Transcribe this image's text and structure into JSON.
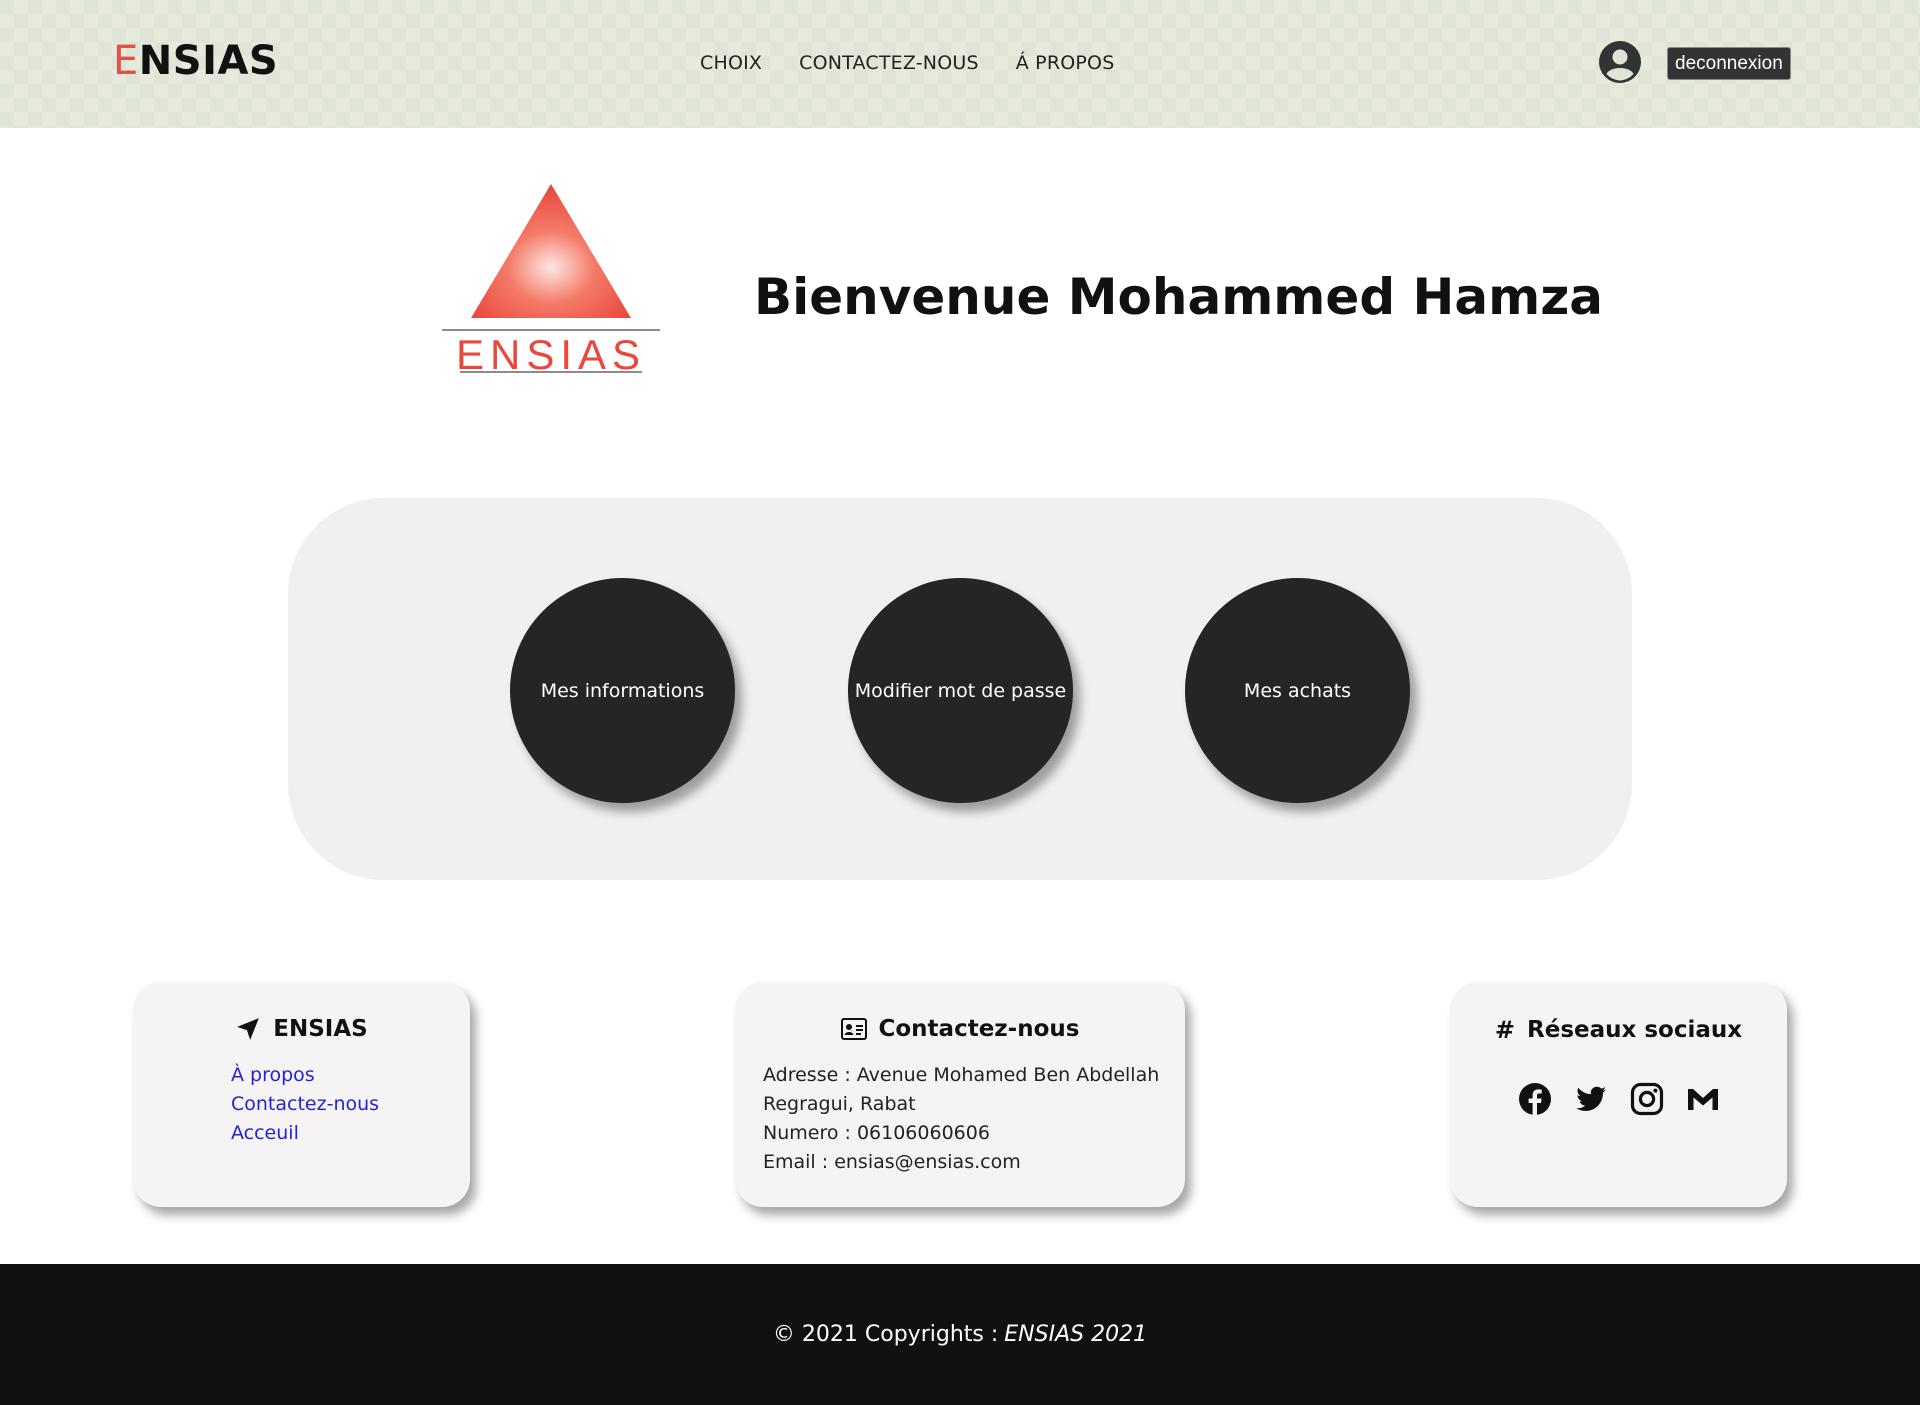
{
  "navbar": {
    "brand_first": "E",
    "brand_rest": "NSIAS",
    "links": [
      "CHOIX",
      "CONTACTEZ-NOUS",
      "Á PROPOS"
    ],
    "logout_label": "deconnexion"
  },
  "hero": {
    "logo_text": "ENSIAS",
    "title": "Bienvenue Mohammed Hamza"
  },
  "actions": [
    "Mes informations",
    "Modifier mot de passe",
    "Mes achats"
  ],
  "footer_cards": {
    "ensias": {
      "title": "ENSIAS",
      "links": [
        "À propos",
        "Contactez-nous",
        "Acceuil"
      ]
    },
    "contact": {
      "title": "Contactez-nous",
      "lines": [
        "Adresse : Avenue Mohamed Ben Abdellah",
        "Regragui, Rabat",
        "Numero : 06106060606",
        "Email : ensias@ensias.com"
      ]
    },
    "social": {
      "title": "Réseaux sociaux",
      "icons": [
        "facebook-icon",
        "twitter-icon",
        "instagram-icon",
        "gmail-icon"
      ]
    }
  },
  "bottom_bar": {
    "text": "© 2021 Copyrights :",
    "brand": "ENSIAS 2021"
  },
  "colors": {
    "navbar_bg": "#dfe5d6",
    "brand_accent": "#e15148",
    "circle_bg": "#252525",
    "link": "#2323d5",
    "footer_bg": "#111111"
  }
}
